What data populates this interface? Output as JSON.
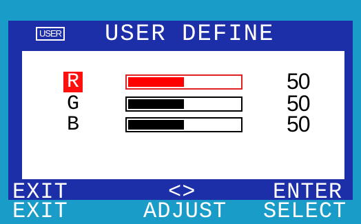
{
  "header": {
    "badge": "USER",
    "title": "USER DEFINE"
  },
  "channels": [
    {
      "label": "R",
      "value": "50",
      "level": 0.5,
      "selected": true
    },
    {
      "label": "G",
      "value": "50",
      "level": 0.5,
      "selected": false
    },
    {
      "label": "B",
      "value": "50",
      "level": 0.5,
      "selected": false
    }
  ],
  "footer": {
    "left_key": "EXIT",
    "left_action": "EXIT",
    "center_key": "<>",
    "center_action": "ADJUST",
    "right_key": "ENTER",
    "right_action": "SELECT"
  },
  "colors": {
    "background": "#1a9cc8",
    "osd_blue": "#1d2fa8",
    "panel": "#ffffff",
    "selected_red": "#ff0000"
  }
}
